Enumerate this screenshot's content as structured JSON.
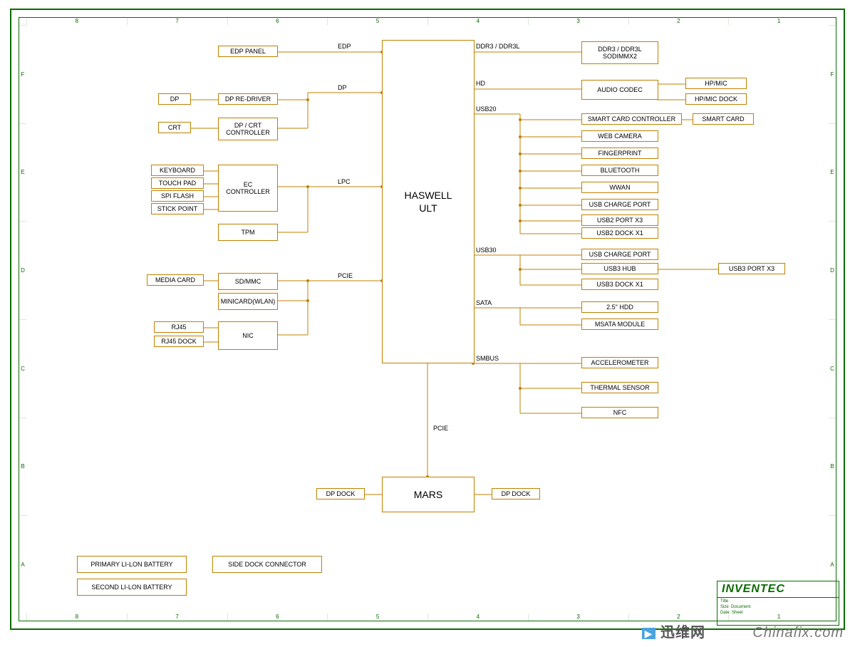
{
  "ruler": {
    "cols": [
      "1",
      "2",
      "3",
      "4",
      "5",
      "6",
      "7",
      "8"
    ],
    "rows": [
      "A",
      "B",
      "C",
      "D",
      "E",
      "F"
    ]
  },
  "cpu": {
    "name": "HASWELL",
    "sub": "ULT"
  },
  "south": "MARS",
  "left_buses": {
    "edp": "EDP",
    "dp": "DP",
    "lpc": "LPC",
    "pcie": "PCIE"
  },
  "right_buses": {
    "ddr": "DDR3 / DDR3L",
    "hd": "HD",
    "usb20": "USB20",
    "usb30": "USB30",
    "sata": "SATA",
    "smbus": "SMBUS"
  },
  "pcie_south": "PCIE",
  "blocks": {
    "edp_panel": "EDP PANEL",
    "dp": "DP",
    "dp_redriver": "DP RE-DRIVER",
    "crt": "CRT",
    "dp_crt_ctrl": "DP / CRT\nCONTROLLER",
    "keyboard": "KEYBOARD",
    "touchpad": "TOUCH PAD",
    "spiflash": "SPI FLASH",
    "stickpoint": "STICK POINT",
    "ec": "EC\nCONTROLLER",
    "tpm": "TPM",
    "mediacard": "MEDIA CARD",
    "sdmmc": "SD/MMC",
    "minicard": "MINICARD(WLAN)",
    "rj45": "RJ45",
    "rj45dock": "RJ45 DOCK",
    "nic": "NIC",
    "ddr": "DDR3 / DDR3L\nSODIMMX2",
    "audio": "AUDIO CODEC",
    "hpmic": "HP/MIC",
    "hpmicdock": "HP/MIC DOCK",
    "smartctrl": "SMART CARD CONTROLLER",
    "smartcard": "SMART CARD",
    "webcam": "WEB CAMERA",
    "finger": "FINGERPRINT",
    "bt": "BLUETOOTH",
    "wwan": "WWAN",
    "usbcharge20": "USB CHARGE PORT",
    "usb2x3": "USB2 PORT X3",
    "usb2dock": "USB2 DOCK X1",
    "usbcharge30": "USB CHARGE PORT",
    "usb3hub": "USB3 HUB",
    "usb3dock": "USB3 DOCK X1",
    "usb3port": "USB3 PORT X3",
    "hdd": "2.5\" HDD",
    "msata": "MSATA MODULE",
    "accel": "ACCELEROMETER",
    "thermal": "THERMAL SENSOR",
    "nfc": "NFC",
    "dpdock1": "DP DOCK",
    "dpdock2": "DP DOCK",
    "primbatt": "PRIMARY LI-LON BATTERY",
    "secbatt": "SECOND LI-LON BATTERY",
    "sidedock": "SIDE DOCK CONNECTOR"
  },
  "titleblock": {
    "company": "INVENTEC"
  },
  "watermark1": "迅维网",
  "watermark2": "Chinafix.com"
}
